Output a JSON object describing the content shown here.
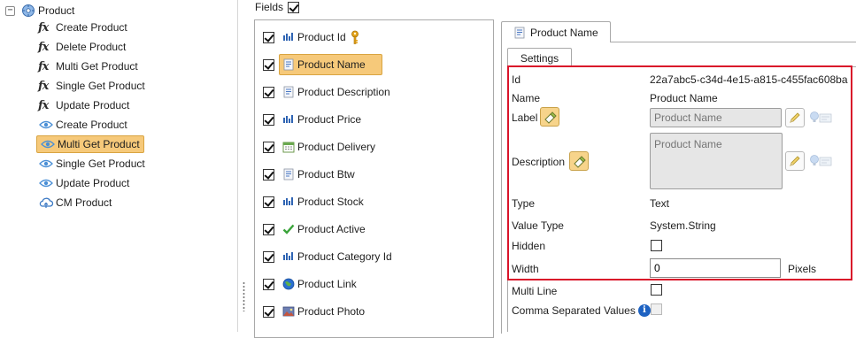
{
  "tree": {
    "root_label": "Product",
    "expander_symbol": "−",
    "items": [
      {
        "label": "Create Product",
        "icon": "fx-icon"
      },
      {
        "label": "Delete Product",
        "icon": "fx-icon"
      },
      {
        "label": "Multi Get Product",
        "icon": "fx-icon"
      },
      {
        "label": "Single Get Product",
        "icon": "fx-icon"
      },
      {
        "label": "Update Product",
        "icon": "fx-icon"
      },
      {
        "label": "Create Product",
        "icon": "eye-icon"
      },
      {
        "label": "Multi Get Product",
        "icon": "eye-icon",
        "selected": true
      },
      {
        "label": "Single Get Product",
        "icon": "eye-icon"
      },
      {
        "label": "Update Product",
        "icon": "eye-icon"
      },
      {
        "label": "CM Product",
        "icon": "cloud-icon"
      }
    ],
    "fx_glyph": "fx"
  },
  "fields": {
    "header_label": "Fields",
    "header_checked": true,
    "items": [
      {
        "label": "Product Id",
        "icon": "key-field-icon",
        "checked": true
      },
      {
        "label": "Product Name",
        "icon": "text-field-icon",
        "checked": true,
        "selected": true
      },
      {
        "label": "Product Description",
        "icon": "text-field-icon",
        "checked": true
      },
      {
        "label": "Product Price",
        "icon": "number-field-icon",
        "checked": true
      },
      {
        "label": "Product Delivery",
        "icon": "calendar-field-icon",
        "checked": true
      },
      {
        "label": "Product Btw",
        "icon": "text-field-icon",
        "checked": true
      },
      {
        "label": "Product Stock",
        "icon": "number-field-icon",
        "checked": true
      },
      {
        "label": "Product Active",
        "icon": "checkmark-field-icon",
        "checked": true
      },
      {
        "label": "Product Category Id",
        "icon": "number-field-icon",
        "checked": true
      },
      {
        "label": "Product Link",
        "icon": "globe-field-icon",
        "checked": true
      },
      {
        "label": "Product Photo",
        "icon": "image-field-icon",
        "checked": true
      }
    ]
  },
  "detail": {
    "tab_label": "Product Name",
    "subtab_label": "Settings",
    "id_label": "Id",
    "id_value": "22a7abc5-c34d-4e15-a815-c455fac608ba",
    "name_label": "Name",
    "name_value": "Product Name",
    "label_label": "Label",
    "label_input_placeholder": "Product Name",
    "description_label": "Description",
    "description_placeholder": "Product Name",
    "type_label": "Type",
    "type_value": "Text",
    "value_type_label": "Value Type",
    "value_type_value": "System.String",
    "hidden_label": "Hidden",
    "hidden_checked": false,
    "width_label": "Width",
    "width_value": "0",
    "width_unit": "Pixels",
    "multi_line_label": "Multi Line",
    "multi_line_checked": false,
    "csv_label": "Comma Separated Values",
    "csv_checked": false,
    "info_glyph": "i",
    "highlight_color": "#d9142a",
    "selection_color": "#f6c97a"
  }
}
